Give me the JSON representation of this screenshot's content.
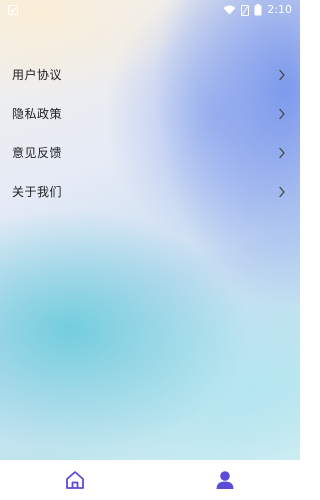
{
  "status_bar": {
    "time": "2:10",
    "icons": [
      "app-notification-icon",
      "wifi-icon",
      "battery-saver-icon",
      "battery-icon"
    ]
  },
  "menu": {
    "items": [
      {
        "label": "用户协议",
        "icon": "chevron-right-icon"
      },
      {
        "label": "隐私政策",
        "icon": "chevron-right-icon"
      },
      {
        "label": "意见反馈",
        "icon": "chevron-right-icon"
      },
      {
        "label": "关于我们",
        "icon": "chevron-right-icon"
      }
    ]
  },
  "tab_bar": {
    "tabs": [
      {
        "icon": "home-icon",
        "active": false
      },
      {
        "icon": "user-icon",
        "active": true
      }
    ],
    "active_color": "#5b4bd6"
  }
}
